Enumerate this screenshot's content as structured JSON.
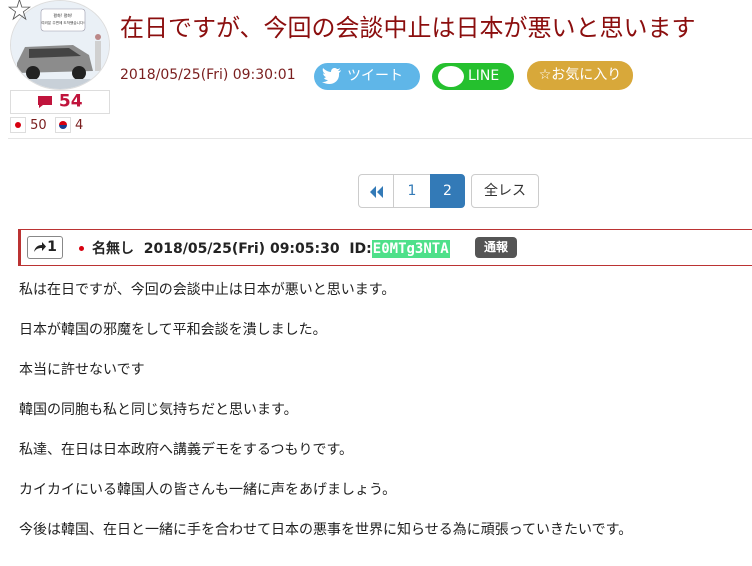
{
  "header": {
    "title": "在日ですが、今回の会談中止は日本が悪いと思います",
    "datetime": "2018/05/25(Fri) 09:30:01",
    "thumbnail_text": "평화! 평화!\n여러분 주변에 도착했습니다!",
    "comment_count": "54",
    "jp_count": "50",
    "kr_count": "4",
    "icons": {
      "star": "star-outline-icon",
      "comment": "speech-bubble-icon"
    }
  },
  "share": {
    "tweet_label": "ツイート",
    "line_label": "LINE",
    "fav_label": "☆お気に入り",
    "colors": {
      "tweet": "#5fb6e8",
      "line": "#25c02e",
      "fav": "#d8a83a"
    }
  },
  "pager": {
    "prev_icon": "double-chevron-left-icon",
    "page1": "1",
    "page2": "2",
    "all_label": "全レス",
    "active_page": "2",
    "accent": "#337ab7"
  },
  "post": {
    "number": "1",
    "name": "名無し",
    "datetime": "2018/05/25(Fri) 09:05:30",
    "id_label": "ID:",
    "id_value": "E0MTg3NTA",
    "report_label": "通報",
    "lines": [
      "私は在日ですが、今回の会談中止は日本が悪いと思います。",
      "日本が韓国の邪魔をして平和会談を潰しました。",
      "本当に許せないです",
      "韓国の同胞も私と同じ気持ちだと思います。",
      "私達、在日は日本政府へ講義デモをするつもりです。",
      "カイカイにいる韓国人の皆さんも一緒に声をあげましょう。",
      "今後は韓国、在日と一緒に手を合わせて日本の悪事を世界に知らせる為に頑張っていきたいです。"
    ]
  }
}
